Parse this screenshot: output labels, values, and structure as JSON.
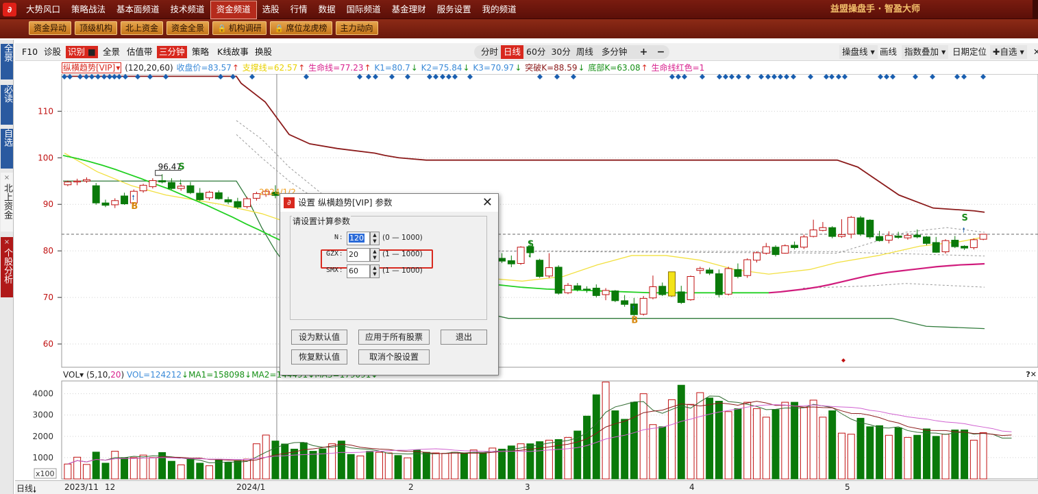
{
  "app": {
    "brand": "益盟操盘手 · 智盈大师"
  },
  "top_menu": [
    "大势风口",
    "策略战法",
    "基本面频道",
    "技术频道",
    "资金频道",
    "选股",
    "行情",
    "数据",
    "国际频道",
    "基金理财",
    "服务设置",
    "我的频道"
  ],
  "sub_menu": [
    "资金异动",
    "顶级机构",
    "北上资金",
    "资金全景",
    "机构调研",
    "席位龙虎榜",
    "主力动向"
  ],
  "side_tabs": [
    "全景",
    "必读",
    "自选",
    "北上资金",
    "个股分析"
  ],
  "tool_left": [
    "F10",
    "诊股",
    "识别",
    "全景",
    "估值带",
    "三分钟",
    "策略",
    "K线故事",
    "换股"
  ],
  "period_tabs": [
    "分时",
    "日线",
    "60分",
    "30分",
    "周线",
    "多分钟"
  ],
  "period_active": "日线",
  "tool_right": [
    "操盘线",
    "画线",
    "指数叠加",
    "日期定位",
    "✚自选"
  ],
  "indicator": {
    "name": "纵横趋势[VIP]",
    "params": "(120,20,60)",
    "close": "收盘价=83.57",
    "support": "支撑线=62.57",
    "life": "生命线=77.23",
    "k1": "K1=80.7",
    "k2": "K2=75.84",
    "k3": "K3=70.97",
    "break": "突破K=88.59",
    "bottom": "底部K=63.08",
    "life_red": "生命线红色=1"
  },
  "vol_indicator": {
    "name": "VOL",
    "params_prefix": "(5,10,",
    "params_20": "20",
    "params_suffix": ")",
    "vol": "VOL=124212",
    "ma1": "MA1=158098",
    "ma2": "MA2=144491",
    "ma3": "MA3=179091"
  },
  "chart_data": {
    "type": "candlestick",
    "price_ticks": [
      "110",
      "100",
      "90",
      "80",
      "70",
      "60"
    ],
    "vol_ticks": [
      "4000",
      "3000",
      "2000",
      "1000"
    ],
    "vol_unit": "x100",
    "date_labels": [
      "2023/11",
      "12",
      "2024/1",
      "2",
      "3",
      "4",
      "5"
    ],
    "annotations": {
      "high": "96.47",
      "date": "2024/1/2",
      "buy": "B",
      "sell": "S"
    },
    "ohlc": [
      [
        94.2,
        95.1,
        93.9,
        94.8
      ],
      [
        94.8,
        95.5,
        94.1,
        95.0
      ],
      [
        95.0,
        95.8,
        94.6,
        95.3
      ],
      [
        94.0,
        94.6,
        89.9,
        90.3
      ],
      [
        90.3,
        91.0,
        89.4,
        89.8
      ],
      [
        89.9,
        91.3,
        89.2,
        90.8
      ],
      [
        91.8,
        92.5,
        89.9,
        90.1
      ],
      [
        90.3,
        93.2,
        90.0,
        92.8
      ],
      [
        92.9,
        94.4,
        92.5,
        94.1
      ],
      [
        93.8,
        95.6,
        93.4,
        95.1
      ],
      [
        95.1,
        96.47,
        94.5,
        94.8
      ],
      [
        94.7,
        95.6,
        93.2,
        93.4
      ],
      [
        93.4,
        94.3,
        92.9,
        93.9
      ],
      [
        94.0,
        94.8,
        92.2,
        92.5
      ],
      [
        92.4,
        93.5,
        90.7,
        91.0
      ],
      [
        91.4,
        92.9,
        90.9,
        92.6
      ],
      [
        92.5,
        93.0,
        91.0,
        91.2
      ],
      [
        91.0,
        91.6,
        90.0,
        90.5
      ],
      [
        90.6,
        91.4,
        89.0,
        89.4
      ],
      [
        89.5,
        91.6,
        89.1,
        91.2
      ],
      [
        91.3,
        92.7,
        90.8,
        92.3
      ],
      [
        92.1,
        93.3,
        91.6,
        92.8
      ],
      [
        92.6,
        94.1,
        91.3,
        91.9
      ],
      [
        91.8,
        92.2,
        87.4,
        87.9
      ],
      [
        87.8,
        88.3,
        83.6,
        84.1
      ],
      [
        84.0,
        84.9,
        80.3,
        81.0
      ],
      [
        80.9,
        81.7,
        78.2,
        78.6
      ],
      [
        78.5,
        79.5,
        76.6,
        77.1
      ],
      [
        77.2,
        78.6,
        76.8,
        78.1
      ],
      [
        78.0,
        79.0,
        77.0,
        77.6
      ],
      [
        72.0,
        72.6,
        70.0,
        70.8
      ],
      [
        69.5,
        72.6,
        69.0,
        72.3
      ],
      [
        72.1,
        73.4,
        71.0,
        71.3
      ],
      [
        71.2,
        74.7,
        70.9,
        74.4
      ],
      [
        74.5,
        76.8,
        74.1,
        76.6
      ],
      [
        76.8,
        77.0,
        73.6,
        74.0
      ],
      [
        74.1,
        74.9,
        73.7,
        74.5
      ],
      [
        74.6,
        75.3,
        72.1,
        72.4
      ],
      [
        72.4,
        73.3,
        70.8,
        71.1
      ],
      [
        71.1,
        73.5,
        70.6,
        73.1
      ],
      [
        73.2,
        75.5,
        72.8,
        74.6
      ],
      [
        74.7,
        81.5,
        74.5,
        78.9
      ],
      [
        79.0,
        80.8,
        77.3,
        77.8
      ],
      [
        77.9,
        79.9,
        77.6,
        78.2
      ],
      [
        78.3,
        79.0,
        76.8,
        77.7
      ],
      [
        77.8,
        79.4,
        77.1,
        78.5
      ],
      [
        78.4,
        79.5,
        77.4,
        77.8
      ],
      [
        77.9,
        79.0,
        76.5,
        77.2
      ],
      [
        77.3,
        81.0,
        77.0,
        80.8
      ],
      [
        80.9,
        82.1,
        78.6,
        79.6
      ],
      [
        78.0,
        78.3,
        74.2,
        74.5
      ],
      [
        74.6,
        79.5,
        74.2,
        76.4
      ],
      [
        76.5,
        76.9,
        70.6,
        70.9
      ],
      [
        71.0,
        73.1,
        70.7,
        72.6
      ],
      [
        72.5,
        73.1,
        71.3,
        71.7
      ],
      [
        71.8,
        72.4,
        71.0,
        71.6
      ],
      [
        72.0,
        72.8,
        70.0,
        70.4
      ],
      [
        70.6,
        72.0,
        69.4,
        71.5
      ],
      [
        71.4,
        71.6,
        69.0,
        69.3
      ],
      [
        69.3,
        70.5,
        68.0,
        68.5
      ],
      [
        68.6,
        69.9,
        66.0,
        66.3
      ],
      [
        66.4,
        70.3,
        66.1,
        69.8
      ],
      [
        69.9,
        74.7,
        69.6,
        72.3
      ],
      [
        72.4,
        73.2,
        70.3,
        70.6
      ],
      [
        70.5,
        71.8,
        70.1,
        71.3
      ],
      [
        71.2,
        72.5,
        68.6,
        68.9
      ],
      [
        69.5,
        74.7,
        69.3,
        74.5
      ],
      [
        75.8,
        76.6,
        75.0,
        76.2
      ],
      [
        75.9,
        76.4,
        74.8,
        75.2
      ],
      [
        75.1,
        76.0,
        70.0,
        70.6
      ],
      [
        70.7,
        76.6,
        70.4,
        76.2
      ],
      [
        76.0,
        77.3,
        74.1,
        74.5
      ],
      [
        74.7,
        78.4,
        74.2,
        78.1
      ],
      [
        78.0,
        79.9,
        77.5,
        79.6
      ],
      [
        79.5,
        81.7,
        79.2,
        80.9
      ],
      [
        80.8,
        81.2,
        78.8,
        79.2
      ],
      [
        79.5,
        81.4,
        79.4,
        81.1
      ],
      [
        81.2,
        82.0,
        80.3,
        80.7
      ],
      [
        80.8,
        83.5,
        80.4,
        83.0
      ],
      [
        83.1,
        86.7,
        82.9,
        84.5
      ],
      [
        84.4,
        86.2,
        84.2,
        85.0
      ],
      [
        85.0,
        85.3,
        82.7,
        83.1
      ],
      [
        83.1,
        86.8,
        82.8,
        83.5
      ],
      [
        83.6,
        87.5,
        82.7,
        87.2
      ],
      [
        87.1,
        87.5,
        83.2,
        83.6
      ],
      [
        86.6,
        86.8,
        82.6,
        83.0
      ],
      [
        83.1,
        84.3,
        82.0,
        82.2
      ],
      [
        82.3,
        84.2,
        81.6,
        83.3
      ],
      [
        83.2,
        84.1,
        82.6,
        82.9
      ],
      [
        82.8,
        83.8,
        82.4,
        83.3
      ],
      [
        83.4,
        84.6,
        82.7,
        83.0
      ],
      [
        83.0,
        83.2,
        81.2,
        81.6
      ],
      [
        81.8,
        83.0,
        79.6,
        79.7
      ],
      [
        79.8,
        82.5,
        79.4,
        82.2
      ],
      [
        82.3,
        83.2,
        80.6,
        80.9
      ],
      [
        81.0,
        81.2,
        80.2,
        80.6
      ],
      [
        80.7,
        82.7,
        80.3,
        82.4
      ],
      [
        82.5,
        83.6,
        82.3,
        83.57
      ]
    ],
    "volume": [
      700,
      1020,
      680,
      1260,
      740,
      1300,
      1000,
      1000,
      1120,
      1000,
      1240,
      830,
      660,
      930,
      740,
      620,
      920,
      780,
      870,
      930,
      1650,
      2060,
      1780,
      1640,
      1400,
      1700,
      1300,
      1410,
      1650,
      1780,
      1150,
      1080,
      1300,
      1250,
      1220,
      1100,
      990,
      1350,
      1250,
      1220,
      1200,
      1250,
      1200,
      1360,
      1200,
      1450,
      1400,
      1550,
      1650,
      1650,
      1750,
      1820,
      1850,
      1950,
      2250,
      2950,
      3950,
      4550,
      3200,
      2800,
      3600,
      4000,
      2550,
      2450,
      3720,
      4400,
      3500,
      4050,
      3800,
      3650,
      3160,
      3300,
      3600,
      3300,
      2900,
      3250,
      3600,
      3600,
      3350,
      3700,
      2900,
      3200,
      2150,
      2100,
      2850,
      2450,
      2500,
      2050,
      2400,
      1950,
      2050,
      2350,
      2000,
      2100,
      2300,
      2300,
      1820,
      2170,
      1900,
      1400,
      2300
    ],
    "green_line": [
      100.5,
      99.9,
      99.2,
      98.4,
      97.5,
      96.5,
      95.5,
      94.4,
      93.4,
      92.2,
      91.0,
      89.8,
      88.5,
      87.2,
      85.8,
      84.5,
      83.1,
      81.8,
      80.5,
      79.2,
      78.0,
      77.0,
      76.1,
      75.4,
      74.9,
      74.5,
      74.1,
      73.9,
      73.7,
      73.6,
      73.5,
      73.3,
      73.1,
      72.8,
      72.5,
      72.2,
      72.0,
      71.8,
      71.7,
      71.6,
      71.5,
      71.4,
      71.3,
      71.2,
      71.1,
      71.0,
      71.0,
      71.0,
      71.0,
      71.0,
      71.0,
      71.0,
      71.0,
      71.0,
      71.0
    ],
    "life_line": [
      71.0,
      71.2,
      71.5,
      71.8,
      72.2,
      72.7,
      73.3,
      73.9,
      74.5,
      75.0,
      75.4,
      75.7,
      76.0,
      76.3,
      76.6,
      76.8,
      77.0,
      77.1,
      77.23
    ]
  }
}
